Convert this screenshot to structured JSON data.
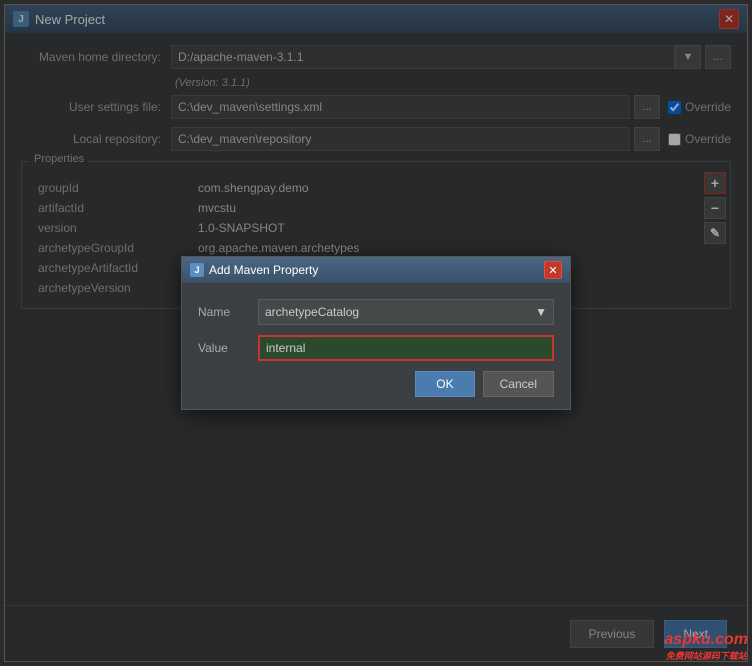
{
  "window": {
    "title": "New Project",
    "close_label": "✕"
  },
  "form": {
    "maven_home_label": "Maven home directory:",
    "maven_home_value": "D:/apache-maven-3.1.1",
    "maven_version": "(Version: 3.1.1)",
    "user_settings_label": "User settings file:",
    "user_settings_value": "C:\\dev_maven\\settings.xml",
    "user_settings_override": "Override",
    "local_repo_label": "Local repository:",
    "local_repo_value": "C:\\dev_maven\\repository",
    "local_repo_override": "Override",
    "properties_title": "Properties",
    "properties": [
      {
        "key": "groupId",
        "value": "com.shengpay.demo"
      },
      {
        "key": "artifactId",
        "value": "mvcstu"
      },
      {
        "key": "version",
        "value": "1.0-SNAPSHOT"
      },
      {
        "key": "archetypeGroupId",
        "value": "org.apache.maven.archetypes"
      },
      {
        "key": "archetypeArtifactId",
        "value": ""
      },
      {
        "key": "archetypeVersion",
        "value": ""
      }
    ]
  },
  "side_buttons": {
    "add": "+",
    "remove": "−",
    "edit": "✎"
  },
  "modal": {
    "title": "Add Maven Property",
    "name_label": "Name",
    "name_value": "archetypeCatalog",
    "value_label": "Value",
    "value_value": "internal",
    "ok_label": "OK",
    "cancel_label": "Cancel",
    "close_label": "✕"
  },
  "navigation": {
    "previous_label": "Previous",
    "next_label": "Next"
  },
  "watermark": {
    "site": "aspku.com",
    "subtext": "免费网站源码下载站"
  }
}
